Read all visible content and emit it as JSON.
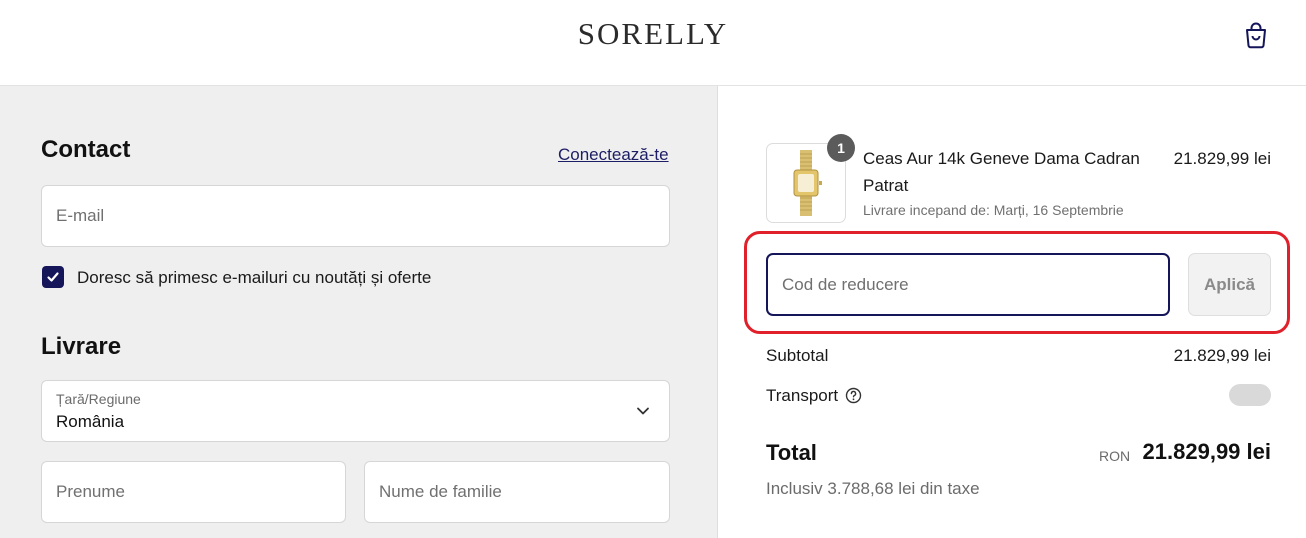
{
  "header": {
    "logo": "SORELLY",
    "cart_icon": "shopping-bag-icon"
  },
  "contact": {
    "title": "Contact",
    "login_link": "Conectează-te",
    "email_placeholder": "E-mail",
    "newsletter_label": "Doresc să primesc e-mailuri cu noutăți și oferte",
    "newsletter_checked": true
  },
  "delivery": {
    "title": "Livrare",
    "country_label": "Țară/Regiune",
    "country_value": "România",
    "first_name_placeholder": "Prenume",
    "last_name_placeholder": "Nume de familie"
  },
  "summary": {
    "product": {
      "quantity": "1",
      "name": "Ceas Aur 14k Geneve Dama Cadran Patrat",
      "delivery_note": "Livrare incepand de: Marți, 16 Septembrie",
      "price": "21.829,99 lei"
    },
    "discount": {
      "placeholder": "Cod de reducere",
      "apply_label": "Aplică"
    },
    "subtotal_label": "Subtotal",
    "subtotal_value": "21.829,99 lei",
    "shipping_label": "Transport",
    "total_label": "Total",
    "currency": "RON",
    "total_value": "21.829,99 lei",
    "tax_note": "Inclusiv 3.788,68 lei din taxe"
  },
  "colors": {
    "accent": "#15155a",
    "highlight": "#e0202a"
  }
}
